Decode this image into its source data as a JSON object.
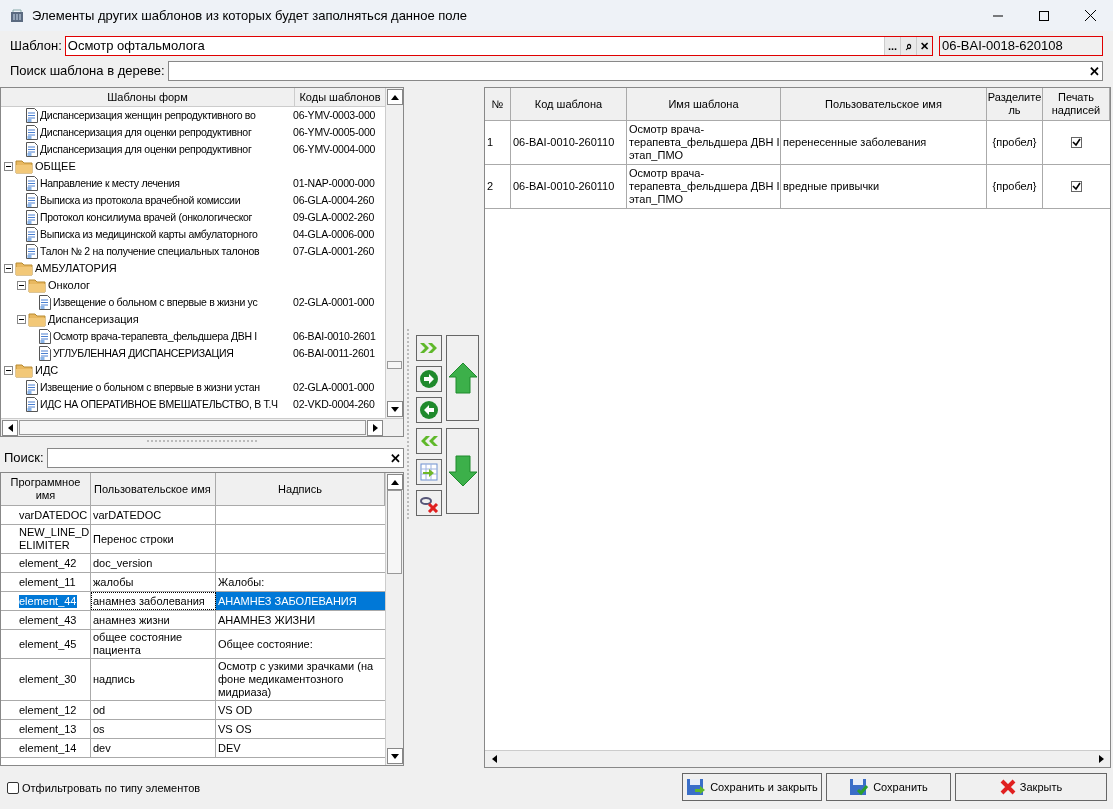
{
  "window": {
    "title": "Элементы других шаблонов из которых будет заполняться данное поле"
  },
  "template": {
    "label": "Шаблон:",
    "value": "Осмотр офтальмолога",
    "code": "06-BAI-0018-620108",
    "buttons": [
      "...",
      "⌕",
      "✕"
    ]
  },
  "tree_search": {
    "label": "Поиск шаблона в дереве:",
    "clear": "✕"
  },
  "tree": {
    "columns": [
      "Шаблоны форм",
      "Коды шаблонов"
    ],
    "nodes": [
      {
        "kind": "group",
        "children": [
          {
            "kind": "doc",
            "name": "Диспансеризация женщин репродуктивного во",
            "code": "06-YMV-0003-000"
          },
          {
            "kind": "doc",
            "name": "Диспансеризация для оценки репродуктивног",
            "code": "06-YMV-0005-000"
          },
          {
            "kind": "doc",
            "name": "Диспансеризация для оценки репродуктивног",
            "code": "06-YMV-0004-000"
          }
        ]
      },
      {
        "kind": "folder",
        "name": "ОБЩЕЕ",
        "expanded": true,
        "children": [
          {
            "kind": "doc",
            "name": "Направление к месту лечения",
            "code": "01-NAP-0000-000"
          },
          {
            "kind": "doc",
            "name": "Выписка из протокола врачебной комиссии",
            "code": "06-GLA-0004-260"
          },
          {
            "kind": "doc",
            "name": "Протокол консилиума врачей (онкологическог",
            "code": "09-GLA-0002-260"
          },
          {
            "kind": "doc",
            "name": "Выписка из медицинской карты амбулаторного",
            "code": "04-GLA-0006-000"
          },
          {
            "kind": "doc",
            "name": "Талон № 2 на получение специальных талонов",
            "code": "07-GLA-0001-260"
          }
        ]
      },
      {
        "kind": "folder",
        "name": "АМБУЛАТОРИЯ",
        "expanded": true,
        "children": [
          {
            "kind": "folder",
            "name": "Онколог",
            "expanded": true,
            "children": [
              {
                "kind": "doc",
                "name": "Извещение о больном с впервые в жизни ус",
                "code": "02-GLA-0001-000"
              }
            ]
          },
          {
            "kind": "folder",
            "name": "Диспансеризация",
            "expanded": true,
            "children": [
              {
                "kind": "doc",
                "name": "Осмотр врача-терапевта_фельдшера ДВН I",
                "code": "06-BAI-0010-2601"
              },
              {
                "kind": "doc",
                "name": "УГЛУБЛЕННАЯ ДИСПАНСЕРИЗАЦИЯ",
                "code": "06-BAI-0011-2601"
              }
            ]
          }
        ]
      },
      {
        "kind": "folder",
        "name": "ИДС",
        "expanded": true,
        "children": [
          {
            "kind": "doc",
            "name": "Извещение о больном с впервые в жизни устан",
            "code": "02-GLA-0001-000"
          },
          {
            "kind": "doc",
            "name": "ИДС НА ОПЕРАТИВНОЕ ВМЕШАТЕЛЬСТВО, В Т.Ч",
            "code": "02-VKD-0004-260"
          }
        ]
      }
    ]
  },
  "element_search": {
    "label": "Поиск:",
    "clear": "✕"
  },
  "elements": {
    "columns": [
      "Программное имя",
      "Пользовательское имя",
      "Надпись"
    ],
    "rows": [
      {
        "program": "varDATEDOC",
        "user": "varDATEDOC",
        "selected": false
      },
      {
        "program": "NEW_LINE_DELIMITER",
        "user": "Перенос строки",
        "selected": false
      },
      {
        "program": "element_42",
        "user": "doc_version",
        "selected": false
      },
      {
        "program": "element_11",
        "user": "жалобы",
        "caption": "Жалобы:",
        "selected": false
      },
      {
        "program": "element_44",
        "user": "анамнез заболевания",
        "caption": "АНАМНЕЗ ЗАБОЛЕВАНИЯ",
        "selected": true
      },
      {
        "program": "element_43",
        "user": "анамнез жизни",
        "caption": "АНАМНЕЗ ЖИЗНИ",
        "selected": false
      },
      {
        "program": "element_45",
        "user": "общее  состояние пациента",
        "caption": "Общее состояние:",
        "selected": false
      },
      {
        "program": "element_30",
        "user": "надпись",
        "caption": "Осмотр с узкими зрачками (на фоне медикаментозного мидриаза)",
        "selected": false
      },
      {
        "program": "element_12",
        "user": "od",
        "caption": "VS OD",
        "selected": false
      },
      {
        "program": "element_13",
        "user": "os",
        "caption": "VS OS",
        "selected": false
      },
      {
        "program": "element_14",
        "user": "dev",
        "caption": "DEV",
        "selected": false
      }
    ]
  },
  "filter": {
    "label": "Отфильтровать по типу элементов",
    "checked": false
  },
  "side_buttons": [
    {
      "kind": "add-all"
    },
    {
      "kind": "add"
    },
    {
      "kind": "remove"
    },
    {
      "kind": "remove-all"
    },
    {
      "kind": "table-import"
    },
    {
      "kind": "unlink"
    }
  ],
  "move_buttons": [
    {
      "kind": "up"
    },
    {
      "kind": "down"
    }
  ],
  "selected": {
    "columns": [
      "№",
      "Код шаблона",
      "Имя шаблона",
      "Пользовательское имя",
      "Разделитель",
      "Печать надписей"
    ],
    "rows": [
      {
        "num": "1",
        "code": "06-BAI-0010-260110",
        "name": "Осмотр врача-терапевта_фельдшера ДВН I этап_ПМО",
        "user": "перенесенные заболевания",
        "separator": "{пробел}",
        "print": true
      },
      {
        "num": "2",
        "code": "06-BAI-0010-260110",
        "name": "Осмотр врача-терапевта_фельдшера ДВН I этап_ПМО",
        "user": "вредные привычки",
        "separator": "{пробел}",
        "print": true
      }
    ]
  },
  "footer": [
    {
      "kind": "save-close",
      "label": "Сохранить и закрыть"
    },
    {
      "kind": "save",
      "label": "Сохранить"
    },
    {
      "kind": "close",
      "label": "Закрыть"
    }
  ]
}
